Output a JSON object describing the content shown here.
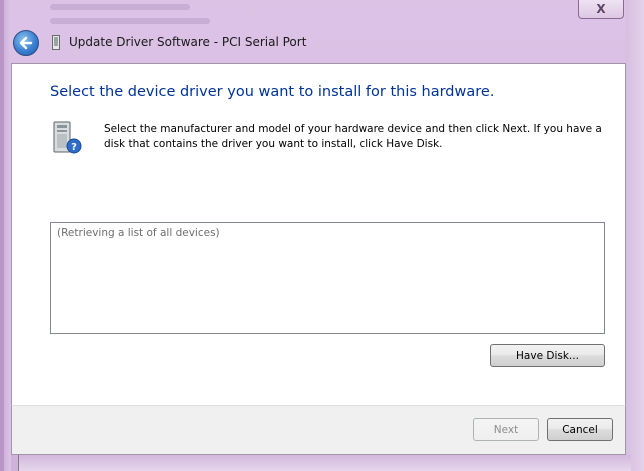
{
  "window": {
    "title": "Update Driver Software - PCI Serial Port",
    "close_label": "X"
  },
  "main": {
    "heading": "Select the device driver you want to install for this hardware.",
    "instructions": "Select the manufacturer and model of your hardware device and then click Next. If you have a disk that contains the driver you want to install, click Have Disk.",
    "device_list_placeholder": "(Retrieving a list of all devices)",
    "have_disk_label": "Have Disk..."
  },
  "footer": {
    "next_label": "Next",
    "next_enabled": false,
    "cancel_label": "Cancel"
  },
  "icons": {
    "back": "back-arrow-icon",
    "title": "device-icon",
    "hardware": "hardware-question-icon"
  },
  "colors": {
    "heading": "#003399",
    "glass": "#d7bde3"
  }
}
